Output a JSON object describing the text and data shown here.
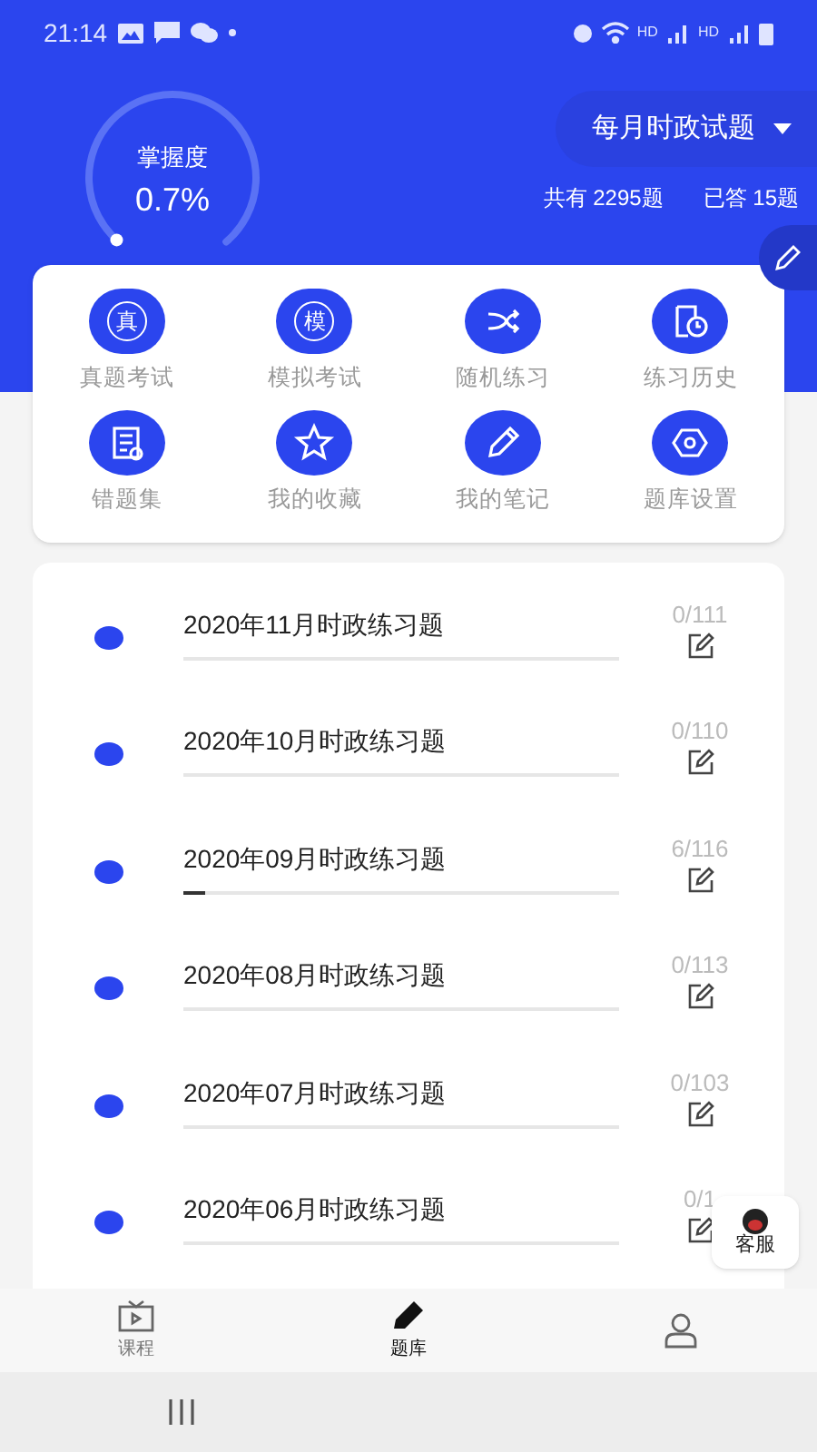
{
  "status_bar": {
    "time": "21:14",
    "hd_1": "HD",
    "hd_2": "HD"
  },
  "mastery": {
    "label": "掌握度",
    "value": "0.7%"
  },
  "bank_selector": {
    "label": "每月时政试题"
  },
  "stats": {
    "total": "共有 2295题",
    "answered": "已答 15题"
  },
  "shortcuts": [
    {
      "label": "真题考试",
      "glyph": "真",
      "kind": "glyph"
    },
    {
      "label": "模拟考试",
      "glyph": "模",
      "kind": "glyph"
    },
    {
      "label": "随机练习",
      "kind": "shuffle"
    },
    {
      "label": "练习历史",
      "kind": "history"
    },
    {
      "label": "错题集",
      "kind": "wrong"
    },
    {
      "label": "我的收藏",
      "kind": "star"
    },
    {
      "label": "我的笔记",
      "kind": "pencil"
    },
    {
      "label": "题库设置",
      "kind": "settings"
    }
  ],
  "exercises": [
    {
      "title": "2020年11月时政练习题",
      "count": "0/111",
      "level": 0
    },
    {
      "title": "2020年10月时政练习题",
      "count": "0/110",
      "level": 0
    },
    {
      "title": "2020年09月时政练习题",
      "count": "6/116",
      "level": 0.05
    },
    {
      "title": "2020年08月时政练习题",
      "count": "0/113",
      "level": 0
    },
    {
      "title": "2020年07月时政练习题",
      "count": "0/103",
      "level": 0
    },
    {
      "title": "2020年06月时政练习题",
      "count": "0/1",
      "level": 0
    }
  ],
  "support_bubble": {
    "label": "客服"
  },
  "bottom_nav": [
    {
      "label": "课程",
      "kind": "tv",
      "selected": false
    },
    {
      "label": "题库",
      "kind": "pencil",
      "selected": true
    },
    {
      "kind": "person",
      "selected": false
    }
  ]
}
